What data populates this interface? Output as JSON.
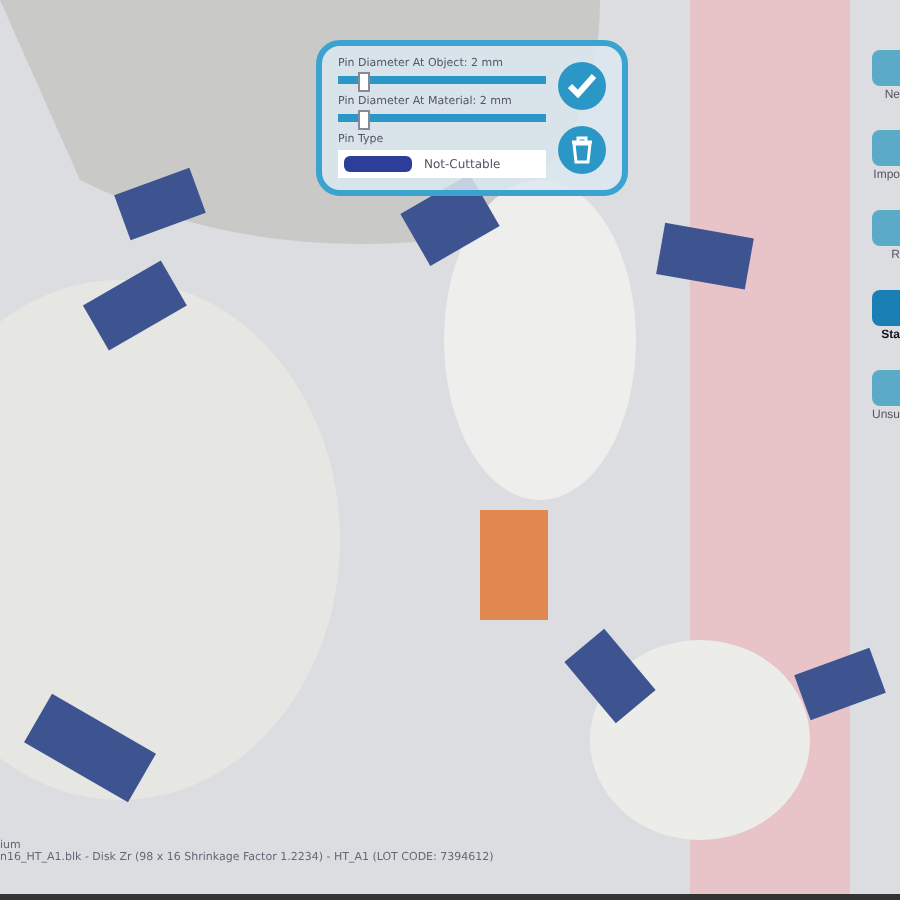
{
  "pin_panel": {
    "sliders": [
      {
        "label": "Pin Diameter At Object: 2 mm",
        "level": 0.12
      },
      {
        "label": "Pin Diameter At Material: 2 mm",
        "level": 0.12
      }
    ],
    "pin_type_label": "Pin Type",
    "pin_type_value": "Not-Cuttable"
  },
  "toolbar": [
    {
      "label": "Ne",
      "selected": false
    },
    {
      "label": "Impo",
      "selected": false
    },
    {
      "label": "R",
      "selected": false
    },
    {
      "label": "Sta",
      "selected": true
    },
    {
      "label": "Unsu",
      "selected": false
    }
  ],
  "status": {
    "line_1": "ium",
    "line_2": "n16_HT_A1.blk - Disk Zr (98 x 16 Shrinkage Factor 1.2234) - HT_A1 (LOT CODE: 7394612)"
  }
}
